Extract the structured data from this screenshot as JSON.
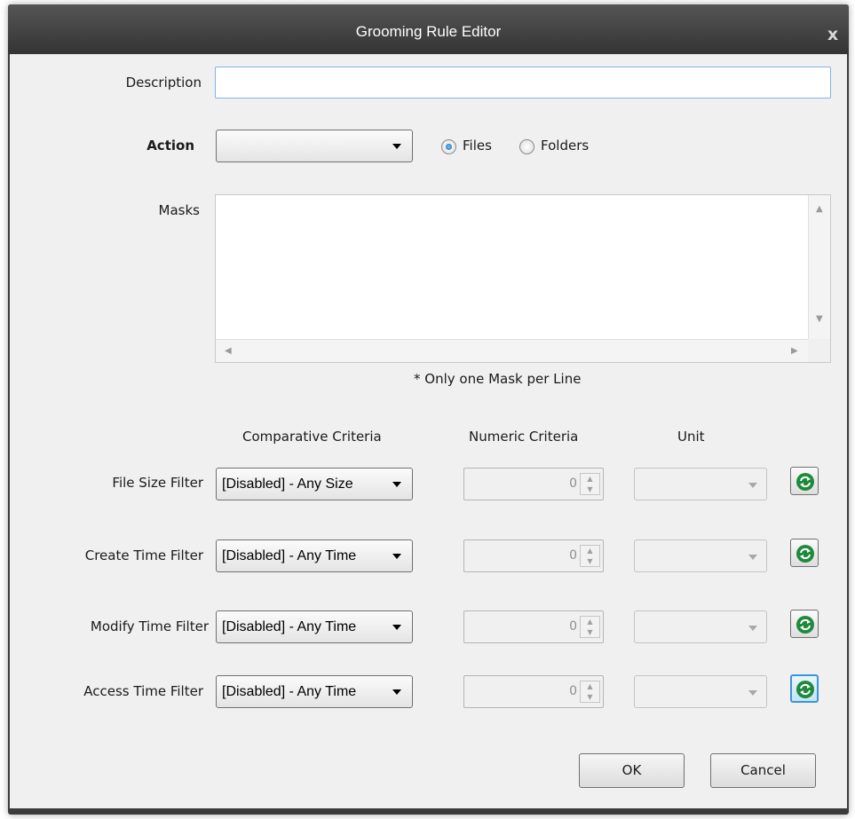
{
  "window": {
    "title": "Grooming Rule Editor",
    "close_glyph": "x"
  },
  "description": {
    "label": "Description",
    "value": ""
  },
  "action": {
    "label": "Action",
    "selected": "",
    "target_options": [
      {
        "label": "Files",
        "checked": true
      },
      {
        "label": "Folders",
        "checked": false
      }
    ]
  },
  "masks": {
    "label": "Masks",
    "value": "",
    "hint": "* Only one Mask per Line"
  },
  "columns": {
    "comparative": "Comparative Criteria",
    "numeric": "Numeric Criteria",
    "unit": "Unit"
  },
  "filters": [
    {
      "label": "File Size Filter",
      "comparative": "[Disabled] - Any Size",
      "numeric": "0",
      "unit": ""
    },
    {
      "label": "Create Time Filter",
      "comparative": "[Disabled] - Any Time",
      "numeric": "0",
      "unit": ""
    },
    {
      "label": "Modify Time Filter",
      "comparative": "[Disabled] - Any Time",
      "numeric": "0",
      "unit": ""
    },
    {
      "label": "Access Time Filter",
      "comparative": "[Disabled] - Any Time",
      "numeric": "0",
      "unit": ""
    }
  ],
  "buttons": {
    "ok": "OK",
    "cancel": "Cancel"
  },
  "colors": {
    "title_bar": "#3c3c3c",
    "refresh_icon": "#1e8a3c",
    "focus_border": "#3c95d8"
  }
}
